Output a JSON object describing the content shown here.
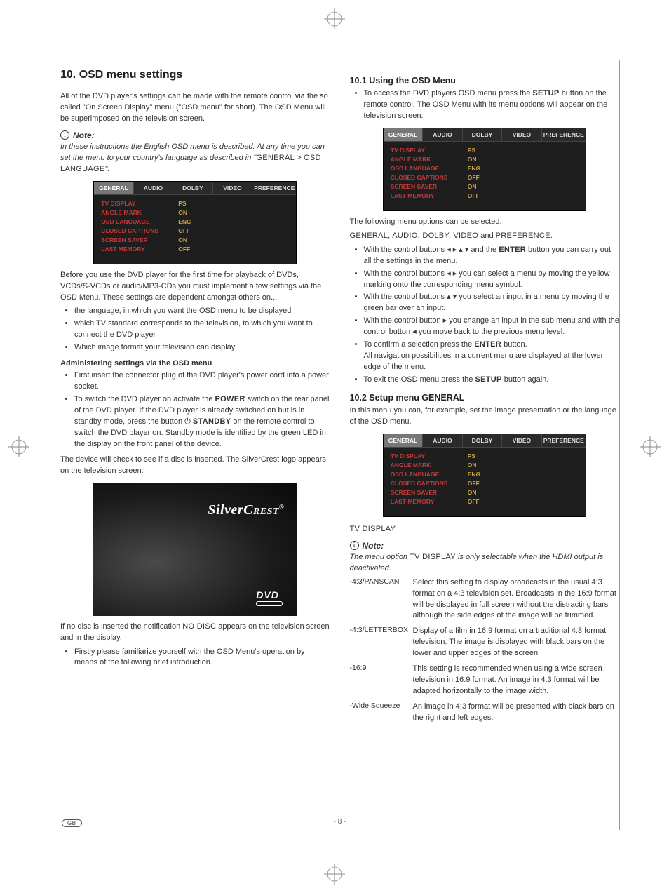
{
  "title": "10. OSD menu settings",
  "intro": "All of the DVD player's settings can be made with the remote control via the so called \"On Screen Display\" menu (\"OSD menu\" for short). The OSD Menu will be superimposed on the television screen.",
  "note_label": "Note:",
  "note1_part1": "In these instructions the English OSD menu is described. At any time you can set the menu to your country's language as described in \"",
  "note1_sc": "GENERAL > OSD LANGUAGE",
  "note1_part2": "\".",
  "osd": {
    "tabs": [
      "GENERAL",
      "AUDIO",
      "DOLBY",
      "VIDEO",
      "PREFERENCE"
    ],
    "rows": [
      {
        "label": "TV DISPLAY",
        "val": "PS"
      },
      {
        "label": "ANGLE MARK",
        "val": "ON"
      },
      {
        "label": "OSD LANGUAGE",
        "val": "ENG"
      },
      {
        "label": "CLOSED CAPTIONS",
        "val": "OFF"
      },
      {
        "label": "SCREEN SAVER",
        "val": "ON"
      },
      {
        "label": "LAST MEMORY",
        "val": "OFF"
      }
    ]
  },
  "before_use": "Before you use the DVD player for the first time for playback of DVDs, VCDs/S-VCDs or audio/MP3-CDs you must implement a few settings via the OSD Menu. These settings are dependent amongst others on...",
  "before_bullets": [
    "the language, in which you want the OSD menu to be displayed",
    "which TV standard corresponds to the television, to which you want to connect the DVD player",
    "Which image format your television can display"
  ],
  "admin_head": "Administering settings via the OSD menu",
  "admin_b1": "First insert the connector plug of the DVD player's power cord into a power socket.",
  "admin_b2_a": "To switch the DVD player on activate the ",
  "admin_b2_power": "POWER",
  "admin_b2_b": " switch on the rear panel of the DVD player. If the DVD player is already switched on but is in standby mode, press the button ",
  "admin_b2_standby": "STANDBY",
  "admin_b2_c": " on the remote control to switch the DVD player on. Standby mode is identified by the green LED in the display on the front panel of the device.",
  "admin_after": "The device will check to see if a disc is inserted. The SilverCrest logo appears on the television screen:",
  "splash_logo_a": "Silver",
  "splash_logo_b": "Crest",
  "splash_dvd": "DVD",
  "nodisc_a": "If no disc is inserted the notification ",
  "nodisc_sc": "NO DISC",
  "nodisc_b": " appears on the television screen and in the display.",
  "nodisc_bullet": "Firstly please familiarize yourself with the OSD Menu's operation by means of the following brief introduction.",
  "h101": "10.1 Using the OSD Menu",
  "using_b1_a": "To access the DVD players OSD menu press the ",
  "using_b1_setup": "SETUP",
  "using_b1_b": " button on the remote control. The OSD Menu with its menu options will appear on the television screen:",
  "following": "The following menu options can be selected:",
  "following2_a": "GENERAL, AUDIO, DOLBY, VIDEO",
  "following2_mid": " and ",
  "following2_b": "PREFERENCE",
  "following2_c": ".",
  "cb1_a": "With the control buttons ",
  "cb1_b": " and the ",
  "cb1_enter": "ENTER",
  "cb1_c": " button you can carry out all the settings in the menu.",
  "cb2_a": "With the control buttons ",
  "cb2_b": " you can select a menu by moving the yellow marking onto the corresponding menu symbol.",
  "cb3_a": "With the control buttons ",
  "cb3_b": " you select an input in a menu by moving the green bar over an input.",
  "cb4_a": "With the control button ",
  "cb4_b": " you change an input in the sub menu and with the control button ",
  "cb4_c": " you move back to the previous menu level.",
  "cb5_a": "To confirm a selection press the ",
  "cb5_enter": "ENTER",
  "cb5_b": " button.",
  "cb5_c": "All navigation possibilities in a current menu are displayed at the lower edge of the menu.",
  "cb6_a": "To exit the OSD menu press the ",
  "cb6_setup": "SETUP",
  "cb6_b": " button again.",
  "h102": "10.2 Setup menu GENERAL",
  "h102_intro": "In this menu you can, for example, set the image presentation or the language of the OSD menu.",
  "tvdisplay": "TV DISPLAY",
  "note2_a": "The menu option ",
  "note2_sc": "TV DISPLAY",
  "note2_b": " is only selectable when the HDMI output is deactivated.",
  "def": [
    {
      "term": "-4:3/PANSCAN",
      "desc": "Select this setting to display broadcasts in the usual 4:3 format on a 4:3 television set. Broadcasts in the 16:9 format will be displayed in full screen without the distracting bars although the side edges of the image will be trimmed."
    },
    {
      "term": "-4:3/LETTERBOX",
      "desc": "Display of a film in 16:9 format on a traditional 4:3 format television. The image is displayed with black bars on the lower and upper edges of the screen."
    },
    {
      "term": "-16:9",
      "desc": "This setting is recommended when using a wide screen television in 16:9 format. An image in 4:3 format will be adapted horizontally to the image width."
    },
    {
      "term": "-Wide Squeeze",
      "desc": "An image in 4:3 format will be presented with black bars on the right and left edges."
    }
  ],
  "page_num": "- 8 -",
  "gb": "GB"
}
